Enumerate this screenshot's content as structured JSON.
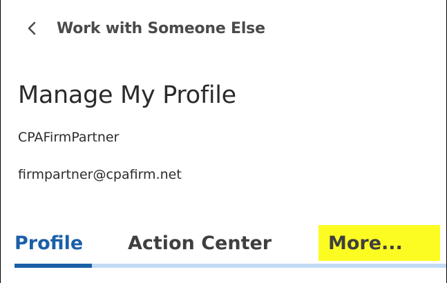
{
  "header": {
    "back_icon": "chevron-left-icon",
    "back_label": "Work with Someone Else"
  },
  "page": {
    "title": "Manage My Profile",
    "user_name": "CPAFirmPartner",
    "user_email": "firmpartner@cpafirm.net"
  },
  "tabs": [
    {
      "label": "Profile",
      "selected": true
    },
    {
      "label": "Action Center",
      "selected": false
    },
    {
      "label": "More...",
      "selected": false,
      "highlighted": true
    }
  ],
  "colors": {
    "accent": "#1b5fa8",
    "tab_track": "#c3dbf3",
    "highlight": "#fdfc22",
    "text": "#2b2b2b"
  }
}
